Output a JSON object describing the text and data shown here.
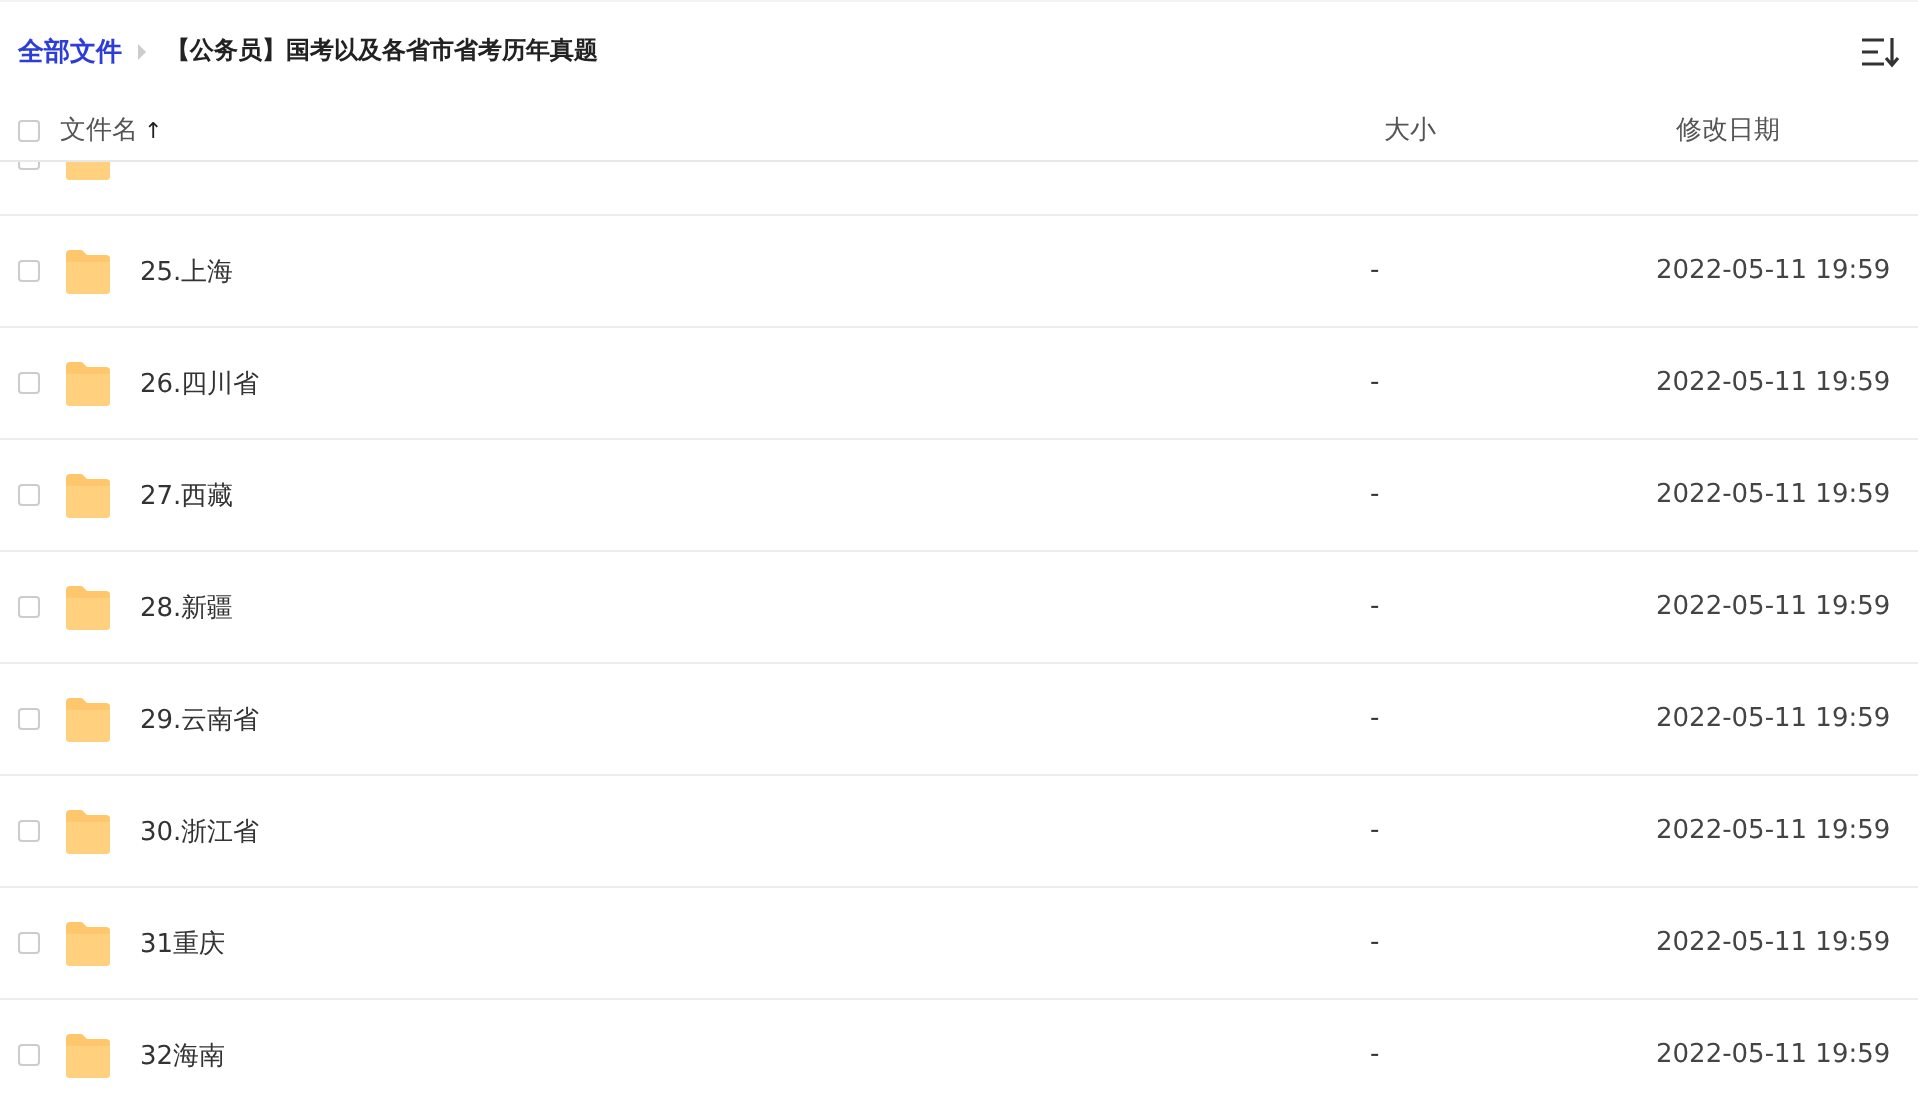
{
  "breadcrumb": {
    "root": "全部文件",
    "current": "【公务员】国考以及各省市省考历年真题"
  },
  "columns": {
    "name": "文件名",
    "sort_arrow": "↑",
    "size": "大小",
    "modified": "修改日期"
  },
  "header_checkbox": {
    "checked": false
  },
  "partial_row": {
    "checked": false
  },
  "rows": [
    {
      "name": "25.上海",
      "size": "-",
      "modified": "2022-05-11 19:59",
      "checked": false
    },
    {
      "name": "26.四川省",
      "size": "-",
      "modified": "2022-05-11 19:59",
      "checked": false
    },
    {
      "name": "27.西藏",
      "size": "-",
      "modified": "2022-05-11 19:59",
      "checked": false
    },
    {
      "name": "28.新疆",
      "size": "-",
      "modified": "2022-05-11 19:59",
      "checked": false
    },
    {
      "name": "29.云南省",
      "size": "-",
      "modified": "2022-05-11 19:59",
      "checked": false
    },
    {
      "name": "30.浙江省",
      "size": "-",
      "modified": "2022-05-11 19:59",
      "checked": false
    },
    {
      "name": "31重庆",
      "size": "-",
      "modified": "2022-05-11 19:59",
      "checked": false
    },
    {
      "name": "32海南",
      "size": "-",
      "modified": "2022-05-11 19:59",
      "checked": false
    }
  ]
}
